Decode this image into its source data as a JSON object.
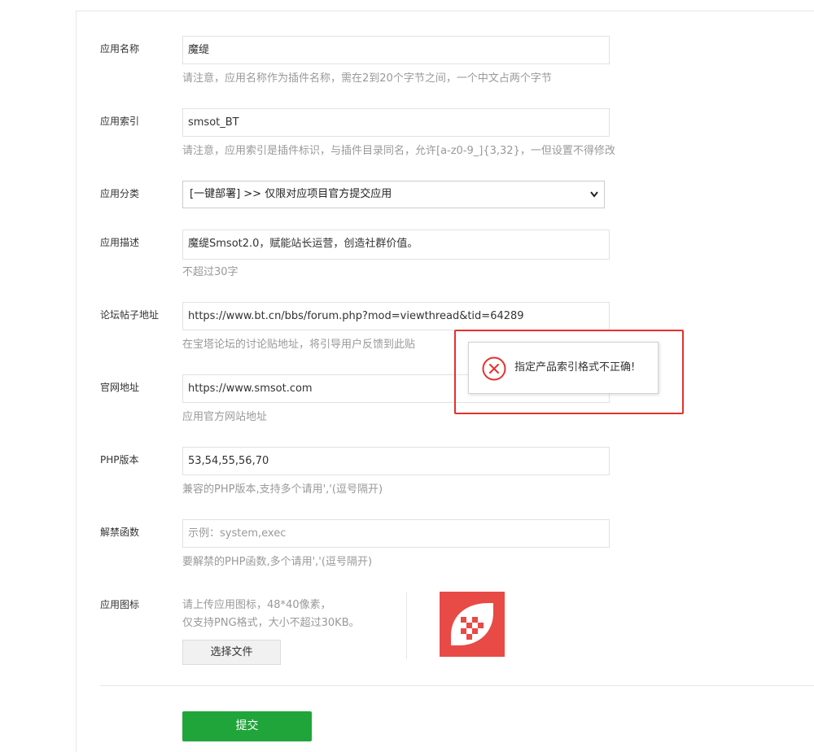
{
  "form": {
    "app_name": {
      "label": "应用名称",
      "value": "魔缇",
      "help": "请注意，应用名称作为插件名称，需在2到20个字节之间，一个中文占两个字节"
    },
    "app_index": {
      "label": "应用索引",
      "value": "smsot_BT",
      "help": "请注意，应用索引是插件标识，与插件目录同名，允许[a-z0-9_]{3,32}，一但设置不得修改"
    },
    "app_category": {
      "label": "应用分类",
      "selected": "[一键部署] >> 仅限对应项目官方提交应用"
    },
    "app_desc": {
      "label": "应用描述",
      "value": "魔缇Smsot2.0，赋能站长运营，创造社群价值。",
      "help": "不超过30字"
    },
    "forum_url": {
      "label": "论坛帖子地址",
      "value": "https://www.bt.cn/bbs/forum.php?mod=viewthread&tid=64289",
      "help": "在宝塔论坛的讨论贴地址，将引导用户反馈到此贴"
    },
    "site_url": {
      "label": "官网地址",
      "value": "https://www.smsot.com",
      "help": "应用官方网站地址"
    },
    "php_version": {
      "label": "PHP版本",
      "value": "53,54,55,56,70",
      "help": "兼容的PHP版本,支持多个请用','(逗号隔开)"
    },
    "unban_funcs": {
      "label": "解禁函数",
      "placeholder": "示例：system,exec",
      "help": "要解禁的PHP函数,多个请用','(逗号隔开)"
    },
    "app_icon": {
      "label": "应用图标",
      "help_line1": "请上传应用图标，48*40像素，",
      "help_line2": "仅支持PNG格式，大小不超过30KB。",
      "choose_file": "选择文件",
      "icon_color": "#e84a46"
    },
    "submit_label": "提交"
  },
  "toast": {
    "message": "指定产品索引格式不正确!",
    "icon": "error-circle-icon",
    "icon_color": "#e4322b"
  },
  "colors": {
    "primary_green": "#20a53a",
    "highlight_red": "#e4322b"
  }
}
